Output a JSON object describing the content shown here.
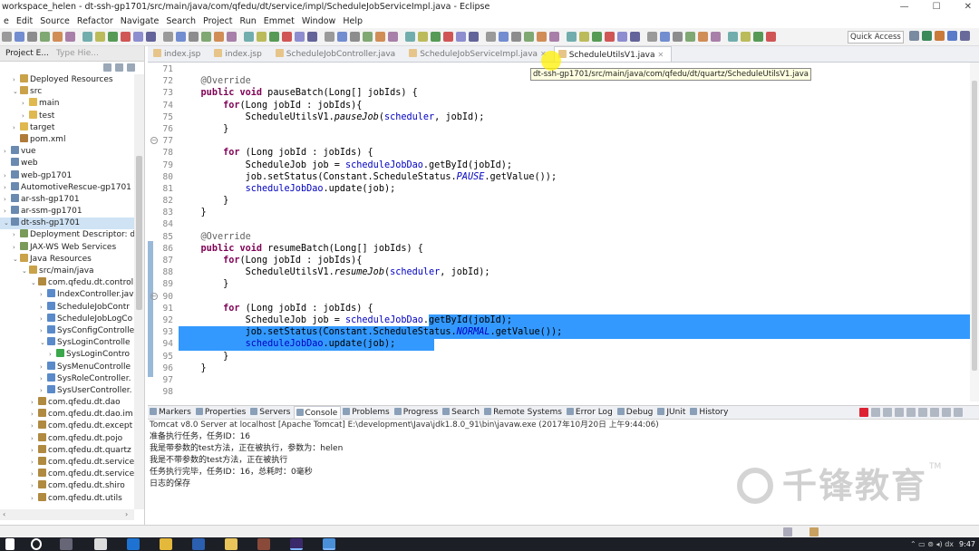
{
  "window": {
    "title": "workspace_helen - dt-ssh-gp1701/src/main/java/com/qfedu/dt/service/impl/ScheduleJobServiceImpl.java - Eclipse",
    "min": "—",
    "max": "☐",
    "close": "✕"
  },
  "menu": [
    "e",
    "Edit",
    "Source",
    "Refactor",
    "Navigate",
    "Search",
    "Project",
    "Run",
    "Emmet",
    "Window",
    "Help"
  ],
  "toolbar": {
    "quick_access": "Quick Access"
  },
  "project_explorer": {
    "tabs": [
      "Project E...",
      "Type Hie..."
    ],
    "tree": [
      {
        "indent": 1,
        "tw": "›",
        "color": "#c9a24a",
        "label": "Deployed Resources"
      },
      {
        "indent": 1,
        "tw": "⌄",
        "color": "#c9a24a",
        "label": "src"
      },
      {
        "indent": 2,
        "tw": "›",
        "color": "#e0b850",
        "label": "main"
      },
      {
        "indent": 2,
        "tw": "›",
        "color": "#e0b850",
        "label": "test"
      },
      {
        "indent": 1,
        "tw": "›",
        "color": "#e0b850",
        "label": "target"
      },
      {
        "indent": 1,
        "tw": "",
        "color": "#b07a3a",
        "label": "pom.xml"
      },
      {
        "indent": 0,
        "tw": "›",
        "color": "#6a8ab0",
        "label": "vue"
      },
      {
        "indent": 0,
        "tw": "",
        "color": "#6a8ab0",
        "label": "web"
      },
      {
        "indent": 0,
        "tw": "›",
        "color": "#6a8ab0",
        "label": "web-gp1701"
      },
      {
        "indent": 0,
        "tw": "›",
        "color": "#6a8ab0",
        "label": "AutomotiveRescue-gp1701"
      },
      {
        "indent": 0,
        "tw": "›",
        "color": "#6a8ab0",
        "label": "ar-ssh-gp1701"
      },
      {
        "indent": 0,
        "tw": "›",
        "color": "#6a8ab0",
        "label": "ar-ssm-gp1701"
      },
      {
        "indent": 0,
        "tw": "⌄",
        "color": "#6a8ab0",
        "label": "dt-ssh-gp1701",
        "selected": true
      },
      {
        "indent": 1,
        "tw": "›",
        "color": "#7a9a5a",
        "label": "Deployment Descriptor: dt"
      },
      {
        "indent": 1,
        "tw": "›",
        "color": "#7a9a5a",
        "label": "JAX-WS Web Services"
      },
      {
        "indent": 1,
        "tw": "⌄",
        "color": "#c9a24a",
        "label": "Java Resources"
      },
      {
        "indent": 2,
        "tw": "⌄",
        "color": "#c9a24a",
        "label": "src/main/java"
      },
      {
        "indent": 3,
        "tw": "⌄",
        "color": "#b08a40",
        "label": "com.qfedu.dt.control"
      },
      {
        "indent": 4,
        "tw": "›",
        "color": "#5a8ac9",
        "label": "IndexController.jav"
      },
      {
        "indent": 4,
        "tw": "›",
        "color": "#5a8ac9",
        "label": "ScheduleJobContr"
      },
      {
        "indent": 4,
        "tw": "›",
        "color": "#5a8ac9",
        "label": "ScheduleJobLogCo"
      },
      {
        "indent": 4,
        "tw": "›",
        "color": "#5a8ac9",
        "label": "SysConfigControlle"
      },
      {
        "indent": 4,
        "tw": "⌄",
        "color": "#5a8ac9",
        "label": "SysLoginControlle"
      },
      {
        "indent": 5,
        "tw": "›",
        "color": "#3aa84a",
        "label": "SysLoginContro"
      },
      {
        "indent": 4,
        "tw": "›",
        "color": "#5a8ac9",
        "label": "SysMenuControlle"
      },
      {
        "indent": 4,
        "tw": "›",
        "color": "#5a8ac9",
        "label": "SysRoleController."
      },
      {
        "indent": 4,
        "tw": "›",
        "color": "#5a8ac9",
        "label": "SysUserController."
      },
      {
        "indent": 3,
        "tw": "›",
        "color": "#b08a40",
        "label": "com.qfedu.dt.dao"
      },
      {
        "indent": 3,
        "tw": "›",
        "color": "#b08a40",
        "label": "com.qfedu.dt.dao.im"
      },
      {
        "indent": 3,
        "tw": "›",
        "color": "#b08a40",
        "label": "com.qfedu.dt.except"
      },
      {
        "indent": 3,
        "tw": "›",
        "color": "#b08a40",
        "label": "com.qfedu.dt.pojo"
      },
      {
        "indent": 3,
        "tw": "›",
        "color": "#b08a40",
        "label": "com.qfedu.dt.quartz"
      },
      {
        "indent": 3,
        "tw": "›",
        "color": "#b08a40",
        "label": "com.qfedu.dt.service"
      },
      {
        "indent": 3,
        "tw": "›",
        "color": "#b08a40",
        "label": "com.qfedu.dt.service"
      },
      {
        "indent": 3,
        "tw": "›",
        "color": "#b08a40",
        "label": "com.qfedu.dt.shiro"
      },
      {
        "indent": 3,
        "tw": "›",
        "color": "#b08a40",
        "label": "com.qfedu.dt.utils"
      }
    ],
    "hscroll_left": "‹",
    "hscroll_right": "›"
  },
  "editor": {
    "tabs": [
      {
        "label": "index.jsp",
        "active": false,
        "close": ""
      },
      {
        "label": "index.jsp",
        "active": false,
        "close": ""
      },
      {
        "label": "ScheduleJobController.java",
        "active": false,
        "close": ""
      },
      {
        "label": "ScheduleJobServiceImpl.java",
        "active": false,
        "close": "✕"
      },
      {
        "label": "ScheduleUtilsV1.java",
        "active": true,
        "close": "✕"
      }
    ],
    "tooltip": "dt-ssh-gp1701/src/main/java/com/qfedu/dt/quartz/ScheduleUtilsV1.java",
    "first_line": 71,
    "highlighted_lines": [
      92,
      93,
      94
    ],
    "lines": [
      [
        {
          "t": ""
        }
      ],
      [
        {
          "t": "    "
        },
        {
          "t": "@Override",
          "c": "an"
        }
      ],
      [
        {
          "t": "    "
        },
        {
          "t": "public",
          "c": "kw"
        },
        {
          "t": " "
        },
        {
          "t": "void",
          "c": "kw"
        },
        {
          "t": " pauseBatch(Long[] jobIds) {"
        }
      ],
      [
        {
          "t": "        "
        },
        {
          "t": "for",
          "c": "kw"
        },
        {
          "t": "(Long jobId : jobIds){"
        }
      ],
      [
        {
          "t": "            ScheduleUtilsV1."
        },
        {
          "t": "pauseJob",
          "c": "it"
        },
        {
          "t": "("
        },
        {
          "t": "scheduler",
          "c": "fld"
        },
        {
          "t": ", jobId);"
        }
      ],
      [
        {
          "t": "        }"
        }
      ],
      [
        {
          "t": ""
        }
      ],
      [
        {
          "t": "        "
        },
        {
          "t": "for",
          "c": "kw"
        },
        {
          "t": " (Long jobId : jobIds) {"
        }
      ],
      [
        {
          "t": "            ScheduleJob job = "
        },
        {
          "t": "scheduleJobDao",
          "c": "fld"
        },
        {
          "t": ".getById(jobId);"
        }
      ],
      [
        {
          "t": "            job.setStatus(Constant.ScheduleStatus."
        },
        {
          "t": "PAUSE",
          "c": "it fld"
        },
        {
          "t": ".getValue());"
        }
      ],
      [
        {
          "t": "            "
        },
        {
          "t": "scheduleJobDao",
          "c": "fld"
        },
        {
          "t": ".update(job);"
        }
      ],
      [
        {
          "t": "        }"
        }
      ],
      [
        {
          "t": "    }"
        }
      ],
      [
        {
          "t": ""
        }
      ],
      [
        {
          "t": "    "
        },
        {
          "t": "@Override",
          "c": "an"
        }
      ],
      [
        {
          "t": "    "
        },
        {
          "t": "public",
          "c": "kw"
        },
        {
          "t": " "
        },
        {
          "t": "void",
          "c": "kw"
        },
        {
          "t": " resumeBatch(Long[] jobIds) {"
        }
      ],
      [
        {
          "t": "        "
        },
        {
          "t": "for",
          "c": "kw"
        },
        {
          "t": "(Long jobId : jobIds){"
        }
      ],
      [
        {
          "t": "            ScheduleUtilsV1."
        },
        {
          "t": "resumeJob",
          "c": "it"
        },
        {
          "t": "("
        },
        {
          "t": "scheduler",
          "c": "fld"
        },
        {
          "t": ", jobId);"
        }
      ],
      [
        {
          "t": "        }"
        }
      ],
      [
        {
          "t": ""
        }
      ],
      [
        {
          "t": "        "
        },
        {
          "t": "for",
          "c": "kw"
        },
        {
          "t": " (Long jobId : jobIds) {"
        }
      ],
      [
        {
          "t": "            ScheduleJob job = "
        },
        {
          "t": "scheduleJobDao",
          "c": "fld"
        },
        {
          "t": ".getById(jobId);"
        }
      ],
      [
        {
          "t": "            job.setStatus(Constant.ScheduleStatus."
        },
        {
          "t": "NORMAL",
          "c": "it fld"
        },
        {
          "t": ".getValue());"
        }
      ],
      [
        {
          "t": "            "
        },
        {
          "t": "scheduleJobDao",
          "c": "fld"
        },
        {
          "t": ".update(job);"
        }
      ],
      [
        {
          "t": "        }"
        }
      ],
      [
        {
          "t": "    }"
        }
      ],
      [
        {
          "t": ""
        }
      ],
      [
        {
          "t": ""
        }
      ]
    ]
  },
  "console": {
    "tabs": [
      "Markers",
      "Properties",
      "Servers",
      "Console",
      "Problems",
      "Progress",
      "Search",
      "Remote Systems",
      "Error Log",
      "Debug",
      "JUnit",
      "History"
    ],
    "active_tab": "Console",
    "header": "Tomcat v8.0 Server at localhost [Apache Tomcat] E:\\development\\Java\\jdk1.8.0_91\\bin\\javaw.exe (2017年10月20日 上午9:44:06)",
    "lines": [
      {
        "text": "准备执行任务，任务ID：16",
        "big": false
      },
      {
        "text": "我是带参数的test方法，正在被执行，参数为：helen",
        "big": false
      },
      {
        "text": "我是不带参数的test方法，正在被执行",
        "big": false
      },
      {
        "text": "任务执行完毕，任务ID：16，总耗时：0毫秒",
        "big": false
      },
      {
        "text": "日志的保存",
        "big": false
      }
    ]
  },
  "watermark": {
    "text": "千锋教育",
    "tm": "TM"
  },
  "taskbar": {
    "time": "9:47",
    "tray": "⌃ ▭ ⊚ ◂) dx"
  }
}
